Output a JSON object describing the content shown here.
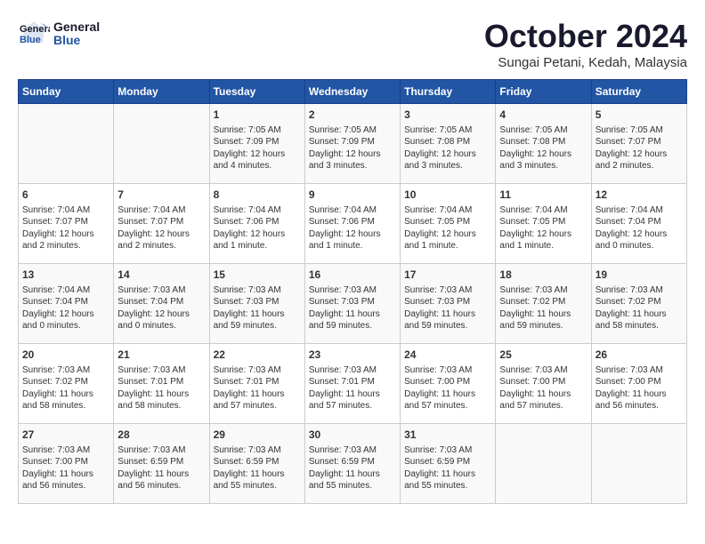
{
  "header": {
    "logo_line1": "General",
    "logo_line2": "Blue",
    "month": "October 2024",
    "location": "Sungai Petani, Kedah, Malaysia"
  },
  "days_of_week": [
    "Sunday",
    "Monday",
    "Tuesday",
    "Wednesday",
    "Thursday",
    "Friday",
    "Saturday"
  ],
  "weeks": [
    [
      {
        "day": "",
        "content": ""
      },
      {
        "day": "",
        "content": ""
      },
      {
        "day": "1",
        "content": "Sunrise: 7:05 AM\nSunset: 7:09 PM\nDaylight: 12 hours\nand 4 minutes."
      },
      {
        "day": "2",
        "content": "Sunrise: 7:05 AM\nSunset: 7:09 PM\nDaylight: 12 hours\nand 3 minutes."
      },
      {
        "day": "3",
        "content": "Sunrise: 7:05 AM\nSunset: 7:08 PM\nDaylight: 12 hours\nand 3 minutes."
      },
      {
        "day": "4",
        "content": "Sunrise: 7:05 AM\nSunset: 7:08 PM\nDaylight: 12 hours\nand 3 minutes."
      },
      {
        "day": "5",
        "content": "Sunrise: 7:05 AM\nSunset: 7:07 PM\nDaylight: 12 hours\nand 2 minutes."
      }
    ],
    [
      {
        "day": "6",
        "content": "Sunrise: 7:04 AM\nSunset: 7:07 PM\nDaylight: 12 hours\nand 2 minutes."
      },
      {
        "day": "7",
        "content": "Sunrise: 7:04 AM\nSunset: 7:07 PM\nDaylight: 12 hours\nand 2 minutes."
      },
      {
        "day": "8",
        "content": "Sunrise: 7:04 AM\nSunset: 7:06 PM\nDaylight: 12 hours\nand 1 minute."
      },
      {
        "day": "9",
        "content": "Sunrise: 7:04 AM\nSunset: 7:06 PM\nDaylight: 12 hours\nand 1 minute."
      },
      {
        "day": "10",
        "content": "Sunrise: 7:04 AM\nSunset: 7:05 PM\nDaylight: 12 hours\nand 1 minute."
      },
      {
        "day": "11",
        "content": "Sunrise: 7:04 AM\nSunset: 7:05 PM\nDaylight: 12 hours\nand 1 minute."
      },
      {
        "day": "12",
        "content": "Sunrise: 7:04 AM\nSunset: 7:04 PM\nDaylight: 12 hours\nand 0 minutes."
      }
    ],
    [
      {
        "day": "13",
        "content": "Sunrise: 7:04 AM\nSunset: 7:04 PM\nDaylight: 12 hours\nand 0 minutes."
      },
      {
        "day": "14",
        "content": "Sunrise: 7:03 AM\nSunset: 7:04 PM\nDaylight: 12 hours\nand 0 minutes."
      },
      {
        "day": "15",
        "content": "Sunrise: 7:03 AM\nSunset: 7:03 PM\nDaylight: 11 hours\nand 59 minutes."
      },
      {
        "day": "16",
        "content": "Sunrise: 7:03 AM\nSunset: 7:03 PM\nDaylight: 11 hours\nand 59 minutes."
      },
      {
        "day": "17",
        "content": "Sunrise: 7:03 AM\nSunset: 7:03 PM\nDaylight: 11 hours\nand 59 minutes."
      },
      {
        "day": "18",
        "content": "Sunrise: 7:03 AM\nSunset: 7:02 PM\nDaylight: 11 hours\nand 59 minutes."
      },
      {
        "day": "19",
        "content": "Sunrise: 7:03 AM\nSunset: 7:02 PM\nDaylight: 11 hours\nand 58 minutes."
      }
    ],
    [
      {
        "day": "20",
        "content": "Sunrise: 7:03 AM\nSunset: 7:02 PM\nDaylight: 11 hours\nand 58 minutes."
      },
      {
        "day": "21",
        "content": "Sunrise: 7:03 AM\nSunset: 7:01 PM\nDaylight: 11 hours\nand 58 minutes."
      },
      {
        "day": "22",
        "content": "Sunrise: 7:03 AM\nSunset: 7:01 PM\nDaylight: 11 hours\nand 57 minutes."
      },
      {
        "day": "23",
        "content": "Sunrise: 7:03 AM\nSunset: 7:01 PM\nDaylight: 11 hours\nand 57 minutes."
      },
      {
        "day": "24",
        "content": "Sunrise: 7:03 AM\nSunset: 7:00 PM\nDaylight: 11 hours\nand 57 minutes."
      },
      {
        "day": "25",
        "content": "Sunrise: 7:03 AM\nSunset: 7:00 PM\nDaylight: 11 hours\nand 57 minutes."
      },
      {
        "day": "26",
        "content": "Sunrise: 7:03 AM\nSunset: 7:00 PM\nDaylight: 11 hours\nand 56 minutes."
      }
    ],
    [
      {
        "day": "27",
        "content": "Sunrise: 7:03 AM\nSunset: 7:00 PM\nDaylight: 11 hours\nand 56 minutes."
      },
      {
        "day": "28",
        "content": "Sunrise: 7:03 AM\nSunset: 6:59 PM\nDaylight: 11 hours\nand 56 minutes."
      },
      {
        "day": "29",
        "content": "Sunrise: 7:03 AM\nSunset: 6:59 PM\nDaylight: 11 hours\nand 55 minutes."
      },
      {
        "day": "30",
        "content": "Sunrise: 7:03 AM\nSunset: 6:59 PM\nDaylight: 11 hours\nand 55 minutes."
      },
      {
        "day": "31",
        "content": "Sunrise: 7:03 AM\nSunset: 6:59 PM\nDaylight: 11 hours\nand 55 minutes."
      },
      {
        "day": "",
        "content": ""
      },
      {
        "day": "",
        "content": ""
      }
    ]
  ]
}
